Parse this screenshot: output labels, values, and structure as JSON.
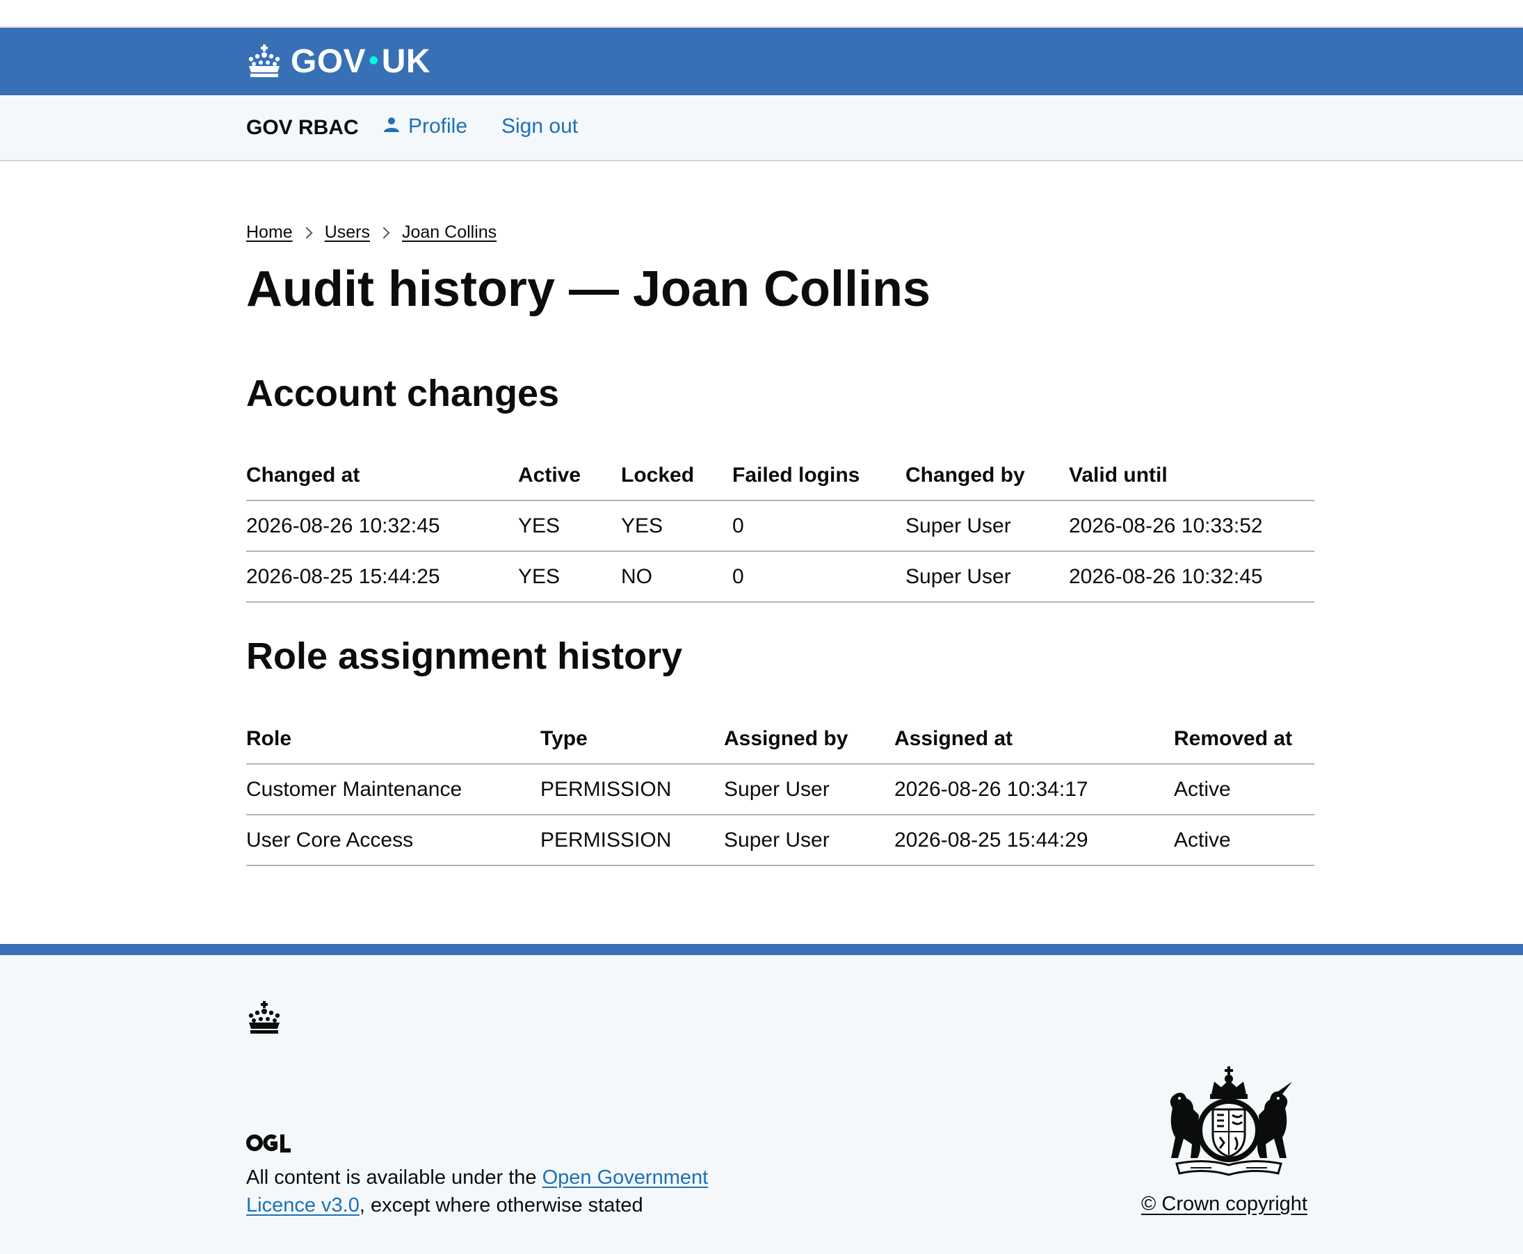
{
  "header": {
    "logo_text_left": "GOV",
    "logo_dot": "•",
    "logo_text_right": "UK",
    "logo_icon": "crown-icon"
  },
  "service": {
    "name": "GOV RBAC",
    "profile_label": "Profile",
    "profile_icon": "person-icon",
    "signout_label": "Sign out"
  },
  "breadcrumb": [
    "Home",
    "Users",
    "Joan Collins"
  ],
  "page_title": "Audit history — Joan Collins",
  "account_changes": {
    "heading": "Account changes",
    "columns": [
      "Changed at",
      "Active",
      "Locked",
      "Failed logins",
      "Changed by",
      "Valid until"
    ],
    "rows": [
      [
        "2026-08-26 10:32:45",
        "YES",
        "YES",
        "0",
        "Super User",
        "2026-08-26 10:33:52"
      ],
      [
        "2026-08-25 15:44:25",
        "YES",
        "NO",
        "0",
        "Super User",
        "2026-08-26 10:32:45"
      ]
    ]
  },
  "role_history": {
    "heading": "Role assignment history",
    "columns": [
      "Role",
      "Type",
      "Assigned by",
      "Assigned at",
      "Removed at"
    ],
    "rows": [
      [
        "Customer Maintenance",
        "PERMISSION",
        "Super User",
        "2026-08-26 10:34:17",
        "Active"
      ],
      [
        "User Core Access",
        "PERMISSION",
        "Super User",
        "2026-08-25 15:44:29",
        "Active"
      ]
    ]
  },
  "footer": {
    "crown_icon": "crown-icon",
    "ogl_logo": "OGL",
    "licence_prefix": "All content is available under the ",
    "licence_link": "Open Government Licence v3.0",
    "licence_suffix": ", except where otherwise stated",
    "crest_icon": "royal-coat-of-arms",
    "copyright": "© Crown copyright"
  },
  "colors": {
    "header_blue": "#3770b5",
    "link_blue": "#1d70b8",
    "service_bg": "#f4f8fb",
    "text": "#0b0c0c",
    "logo_dot": "#00ffe0"
  }
}
